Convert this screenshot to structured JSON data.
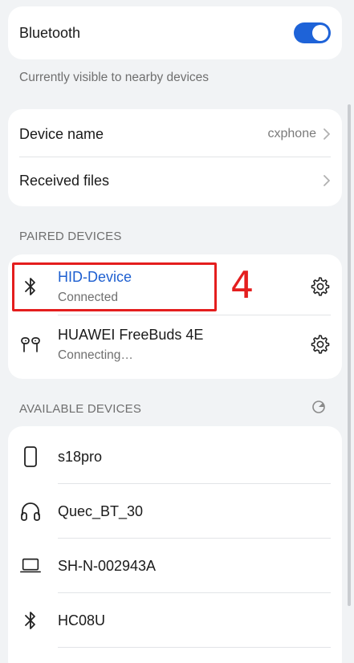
{
  "bluetooth": {
    "label": "Bluetooth",
    "enabled": true,
    "visibility_note": "Currently visible to nearby devices"
  },
  "settings": {
    "device_name_label": "Device name",
    "device_name_value": "cxphone",
    "received_files_label": "Received files"
  },
  "paired": {
    "header": "PAIRED DEVICES",
    "devices": [
      {
        "name": "HID-Device",
        "status": "Connected",
        "icon": "bluetooth-icon"
      },
      {
        "name": "HUAWEI FreeBuds 4E",
        "status": "Connecting…",
        "icon": "earbuds-icon"
      }
    ]
  },
  "annotation": {
    "label": "4",
    "color": "#e41e1e"
  },
  "available": {
    "header": "AVAILABLE DEVICES",
    "devices": [
      {
        "name": "s18pro",
        "icon": "phone-icon"
      },
      {
        "name": "Quec_BT_30",
        "icon": "headphones-icon"
      },
      {
        "name": "SH-N-002943A",
        "icon": "laptop-icon"
      },
      {
        "name": "HC08U",
        "icon": "bluetooth-icon"
      }
    ]
  },
  "colors": {
    "accent": "#1e63d8",
    "active_text": "#1e5fd0",
    "annotation": "#e41e1e"
  }
}
